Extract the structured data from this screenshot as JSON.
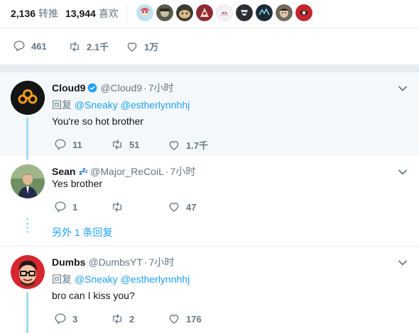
{
  "stats": {
    "retweets": {
      "count": "2,136",
      "label": "转推"
    },
    "likes": {
      "count": "13,944",
      "label": "喜欢"
    },
    "liker_avatars": [
      "avatar-1",
      "avatar-2",
      "avatar-3",
      "avatar-4",
      "avatar-5",
      "avatar-6",
      "avatar-7",
      "avatar-8",
      "avatar-9"
    ]
  },
  "main_tweet_actions": {
    "replies": "461",
    "retweets": "2.1千",
    "likes": "1万"
  },
  "replies": [
    {
      "name": "Cloud9",
      "handle": "@Cloud9",
      "separator": "·",
      "time": "7小时",
      "verified": true,
      "reply_prefix": "回复",
      "mentions": [
        "@Sneaky",
        "@estherlynnhhj"
      ],
      "text": "You're so hot brother",
      "actions": {
        "replies": "11",
        "retweets": "51",
        "likes": "1.7千"
      }
    },
    {
      "name": "Sean",
      "name_emoji": "💤",
      "handle": "@Major_ReCoiL",
      "separator": "·",
      "time": "7小时",
      "text": "Yes brother",
      "actions": {
        "replies": "1",
        "retweets": "",
        "likes": "47"
      },
      "more_replies": "另外 1 条回复"
    },
    {
      "name": "Dumbs",
      "handle": "@DumbsYT",
      "separator": "·",
      "time": "7小时",
      "reply_prefix": "回复",
      "mentions": [
        "@Sneaky",
        "@estherlynnhhj"
      ],
      "text": "bro can I kiss you?",
      "actions": {
        "replies": "3",
        "retweets": "2",
        "likes": "176"
      }
    }
  ],
  "colors": {
    "accent": "#1da1f2",
    "muted": "#657786",
    "thread": "#9fdcf0",
    "highlight_bg": "#f5f8fa"
  }
}
